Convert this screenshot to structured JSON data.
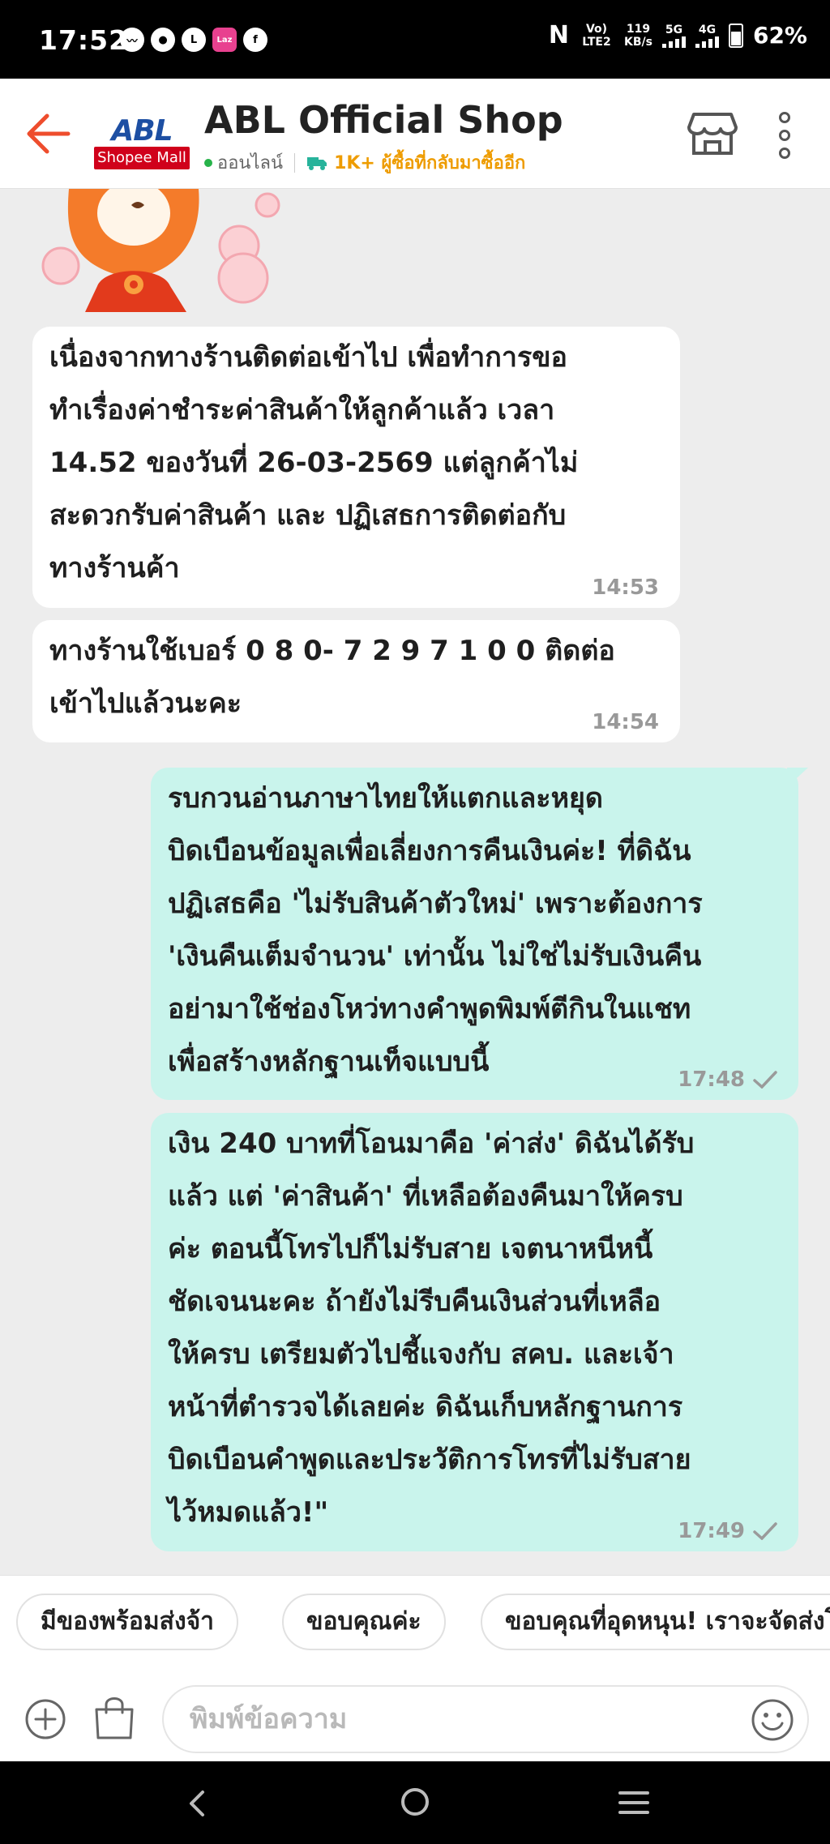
{
  "status_bar": {
    "time": "17:52",
    "notif_icons": [
      "messenger-icon",
      "chat-icon",
      "line-icon",
      "lazada-icon",
      "facebook-icon"
    ],
    "nfc": "N",
    "volte": "Vo) LTE2",
    "speed_value": "119",
    "speed_unit": "KB/s",
    "net1": "5G",
    "net2": "4G",
    "battery": "62%"
  },
  "header": {
    "logo_text": "ABL",
    "logo_badge": "Shopee Mall",
    "shop_name": "ABL Official Shop",
    "online_status": "ออนไลน์",
    "buyers_note": "1K+ ผู้ซื้อที่กลับมาซื้ออีก",
    "colors": {
      "back_arrow": "#ee4d2d",
      "buyers_note": "#ee9c00",
      "online_dot": "#27b34a",
      "mall_badge": "#d0011b"
    }
  },
  "messages": [
    {
      "side": "incoming",
      "text": "เนื่องจากทางร้านติดต่อเข้าไป เพื่อทำการขอ\nทำเรื่องค่าชำระค่าสินค้าให้ลูกค้าแล้ว เวลา\n14.52 ของวันที่ 26-03-2569 แต่ลูกค้าไม่\nสะดวกรับค่าสินค้า และ ปฏิเสธการติดต่อกับ\nทางร้านค้า",
      "time": "14:53"
    },
    {
      "side": "incoming",
      "text": "ทางร้านใช้เบอร์ 0 8 0- 7 2 9 7 1 0 0 ติดต่อ\nเข้าไปแล้วนะคะ",
      "time": "14:54"
    },
    {
      "side": "outgoing",
      "text": "รบกวนอ่านภาษาไทยให้แตกและหยุด\nบิดเบือนข้อมูลเพื่อเลี่ยงการคืนเงินค่ะ! ที่ดิฉัน\nปฏิเสธคือ 'ไม่รับสินค้าตัวใหม่' เพราะต้องการ\n'เงินคืนเต็มจำนวน' เท่านั้น ไม่ใช่ไม่รับเงินคืน\nอย่ามาใช้ช่องโหว่ทางคำพูดพิมพ์ตีกินในแชท\nเพื่อสร้างหลักฐานเท็จแบบนี้",
      "time": "17:48"
    },
    {
      "side": "outgoing",
      "text": "เงิน 240 บาทที่โอนมาคือ 'ค่าส่ง' ดิฉันได้รับ\nแล้ว แต่ 'ค่าสินค้า' ที่เหลือต้องคืนมาให้ครบ\nค่ะ ตอนนี้โทรไปก็ไม่รับสาย เจตนาหนีหนี้\nชัดเจนนะคะ ถ้ายังไม่รีบคืนเงินส่วนที่เหลือ\nให้ครบ เตรียมตัวไปชี้แจงกับ สคบ. และเจ้า\nหน้าที่ตำรวจได้เลยค่ะ ดิฉันเก็บหลักฐานการ\nบิดเบือนคำพูดและประวัติการโทรที่ไม่รับสาย\nไว้หมดแล้ว!\"",
      "time": "17:49"
    }
  ],
  "quick_replies": [
    "มีของพร้อมส่งจ้า",
    "ขอบคุณค่ะ",
    "ขอบคุณที่อุดหนุน! เราจะจัดส่งโดยเร็ว"
  ],
  "input": {
    "placeholder": "พิมพ์ข้อความ",
    "value": ""
  },
  "navbar": {
    "icons": [
      "back-icon",
      "home-icon",
      "recent-apps-icon"
    ]
  }
}
